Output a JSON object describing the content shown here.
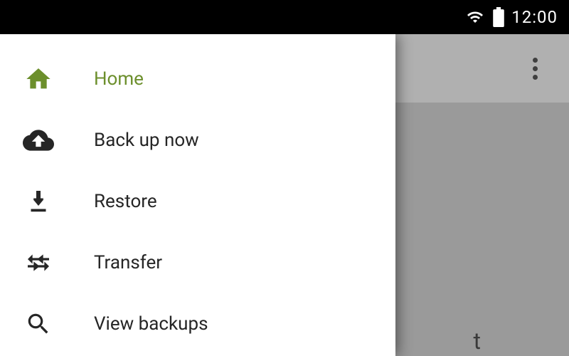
{
  "status_bar": {
    "time": "12:00"
  },
  "drawer": {
    "items": [
      {
        "label": "Home"
      },
      {
        "label": "Back up now"
      },
      {
        "label": "Restore"
      },
      {
        "label": "Transfer"
      },
      {
        "label": "View backups"
      }
    ]
  },
  "background": {
    "partial_text": "t"
  },
  "colors": {
    "accent": "#6c8f2c",
    "status_bar_bg": "#000000",
    "drawer_bg": "#ffffff",
    "scrim_bg": "#9a9a9a"
  }
}
